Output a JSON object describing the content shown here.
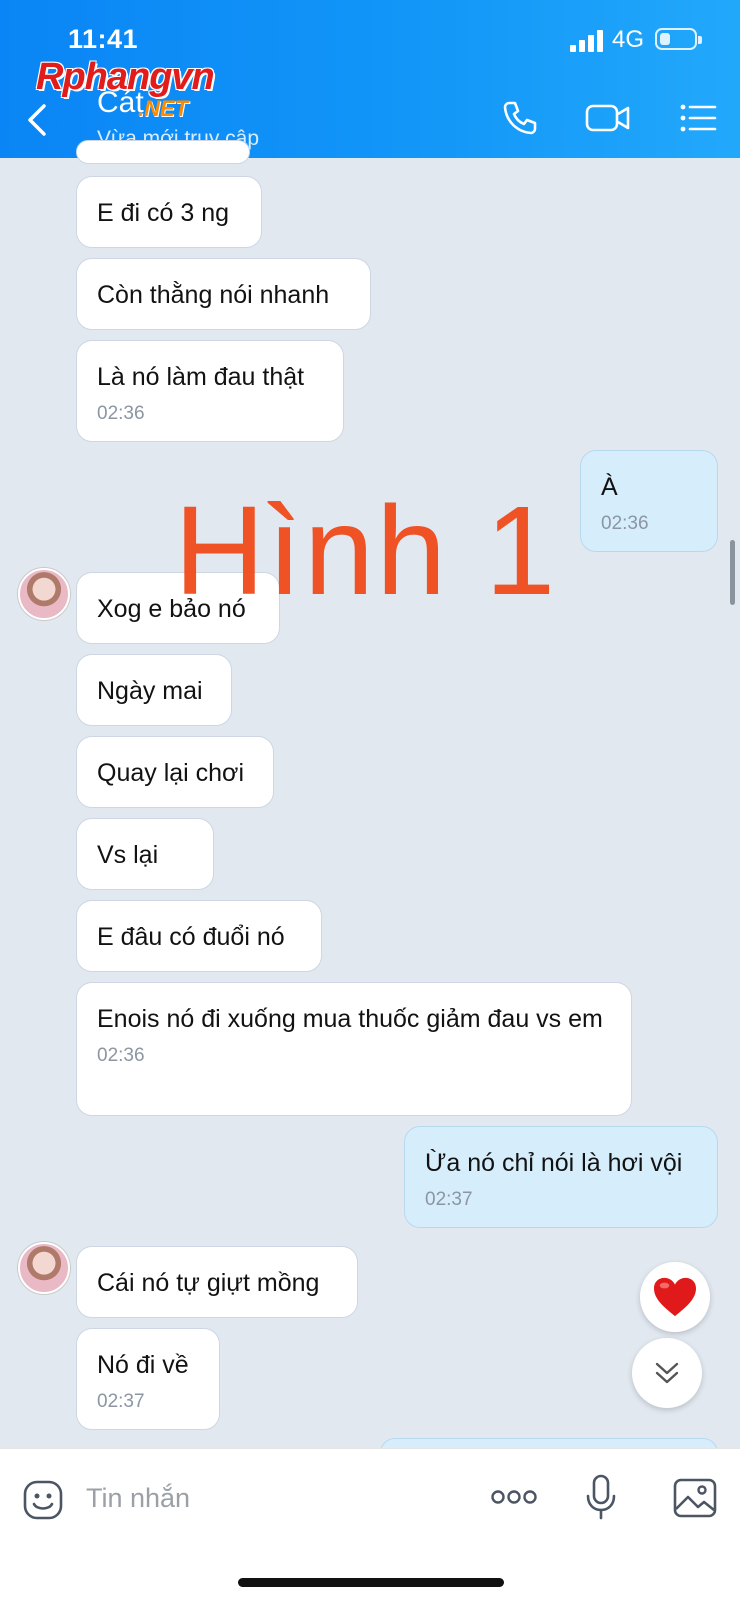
{
  "status_bar": {
    "time": "11:41",
    "network": "4G"
  },
  "header": {
    "name": "Cát",
    "subtitle": "Vừa mới truy cập",
    "watermark_logo": "Rphangvn",
    "watermark_domain": ".NET",
    "icons": [
      "back-arrow-icon",
      "phone-icon",
      "video-call-icon",
      "menu-list-icon"
    ]
  },
  "messages": [
    {
      "side": "them",
      "text": "E đi có 3 ng",
      "time": ""
    },
    {
      "side": "them",
      "text": "Còn thằng nói nhanh",
      "time": ""
    },
    {
      "side": "them",
      "text": "Là nó làm đau thật",
      "time": "02:36"
    },
    {
      "side": "me",
      "text": "À",
      "time": "02:36"
    },
    {
      "side": "them",
      "text": "Xog e bảo nó",
      "time": ""
    },
    {
      "side": "them",
      "text": "Ngày mai",
      "time": ""
    },
    {
      "side": "them",
      "text": "Quay lại chơi",
      "time": ""
    },
    {
      "side": "them",
      "text": "Vs lại",
      "time": ""
    },
    {
      "side": "them",
      "text": "E đâu có đuổi nó",
      "time": ""
    },
    {
      "side": "them",
      "text": "Enois nó đi xuống mua thuốc giảm đau vs em",
      "time": "02:36"
    },
    {
      "side": "me",
      "text": "Ừa nó chỉ nói là hơi vội",
      "time": "02:37"
    },
    {
      "side": "them",
      "text": "Cái nó tự giựt mồng",
      "time": ""
    },
    {
      "side": "them",
      "text": "Nó đi về",
      "time": "02:37"
    }
  ],
  "overlay": {
    "caption": "Hình 1"
  },
  "composer": {
    "placeholder": "Tin nhắn",
    "icons": [
      "sticker-icon",
      "more-dots-icon",
      "microphone-icon",
      "image-icon"
    ]
  },
  "floating": {
    "icons": [
      "heart-reaction-icon",
      "scroll-down-icon"
    ]
  },
  "colors": {
    "header": "#0a85f5",
    "my_bubble": "#d6eefc",
    "background": "#e2e8f0",
    "watermark": "#f04a1a"
  }
}
